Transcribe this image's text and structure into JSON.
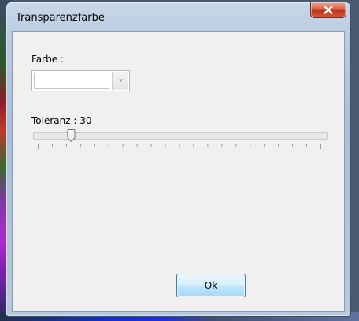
{
  "window": {
    "title": "Transparenzfarbe"
  },
  "color_field": {
    "label": "Farbe :",
    "value": ""
  },
  "tolerance": {
    "label": "Toleranz : 30",
    "value": 30,
    "min": 0,
    "max": 255,
    "tick_count": 20
  },
  "buttons": {
    "ok_label": "Ok"
  },
  "colors": {
    "ok_border": "#3c7fb1",
    "close_red": "#c0331a"
  }
}
